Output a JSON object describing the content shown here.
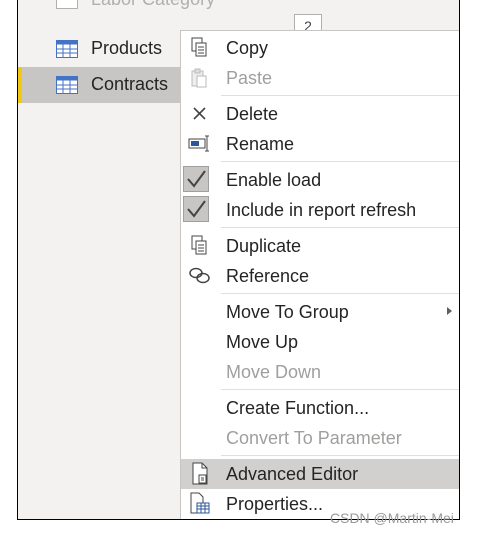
{
  "queries": {
    "partial_item": "Labor Category",
    "badge": "2",
    "items": [
      {
        "label": "Products",
        "icon": "table-icon",
        "selected": false
      },
      {
        "label": "Contracts",
        "icon": "table-icon",
        "selected": true
      }
    ]
  },
  "context_menu": {
    "copy": "Copy",
    "paste": "Paste",
    "delete": "Delete",
    "rename": "Rename",
    "enable_load": "Enable load",
    "include_refresh": "Include in report refresh",
    "duplicate": "Duplicate",
    "reference": "Reference",
    "move_to_group": "Move To Group",
    "move_up": "Move Up",
    "move_down": "Move Down",
    "create_function": "Create Function...",
    "convert_to_parameter": "Convert To Parameter",
    "advanced_editor": "Advanced Editor",
    "properties": "Properties..."
  },
  "colors": {
    "accent": "#f2c811",
    "selected_bg": "#c8c6c4",
    "hover_bg": "#d2d0ce",
    "disabled_text": "#a19f9d"
  },
  "watermark": "CSDN @Martin-Mei"
}
